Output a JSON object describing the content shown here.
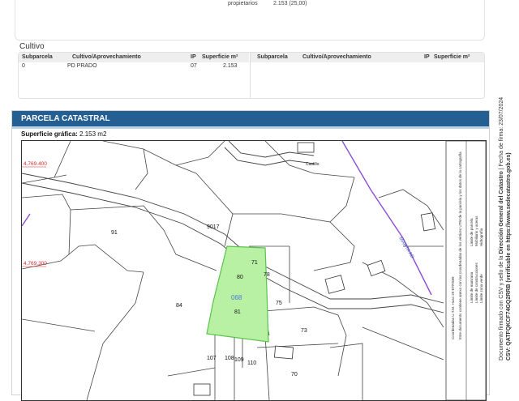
{
  "top_section": {
    "label": "propietarios",
    "value": "2.153 (25,00)"
  },
  "cultivo": {
    "title": "Cultivo",
    "headers": [
      "Subparcela",
      "Cultivo/Aprovechamiento",
      "IP",
      "Superficie m²"
    ],
    "left_row": {
      "subparcela": "0",
      "cultivo": "PD PRADO",
      "ip": "07",
      "superficie": "2.153"
    }
  },
  "parcela": {
    "title": "PARCELA CATASTRAL",
    "superficie_label": "Superficie gráfica:",
    "superficie_value": "2.153 m2"
  },
  "map": {
    "coord_top": "4.769.400",
    "coord_mid": "4.769.300",
    "highlight_code": "068",
    "highlight_number": "81",
    "parcel_numbers": [
      "91",
      "84",
      "80",
      "78",
      "75",
      "73",
      "107",
      "108",
      "109",
      "110",
      "70",
      "71"
    ],
    "road_label": "9017",
    "road_name": "MARTA AD",
    "castillo": "Castillo",
    "legend_items": [
      "Límite de manzana",
      "Límite de parcela",
      "Límite de construcciones",
      "Mobiliario y aceras",
      "Límite zona verde",
      "Hidrografía"
    ],
    "legend_note": "Coordenadas U.T.M. Huso 29 ETRS89",
    "legend_note2": "Este documento contiene anexo con las coordenadas de los vértices UTM de la parcela y los datos de la cartografía",
    "colors": {
      "highlight_fill": "#b8f0a4",
      "highlight_stroke": "#58c44a",
      "road": "#8b4fd3",
      "coords": "#d22b2b"
    }
  },
  "side_note": {
    "line1_prefix": "Documento firmado con CSV y sello de la",
    "line1_bold": "Dirección General del Catastro",
    "line1_sep": "Fecha de firma: 23/07/2024",
    "line2": "CSV: QATFQKCF74GQ2RRB (verificable en https://www.sedecatastro.gob.es)"
  }
}
